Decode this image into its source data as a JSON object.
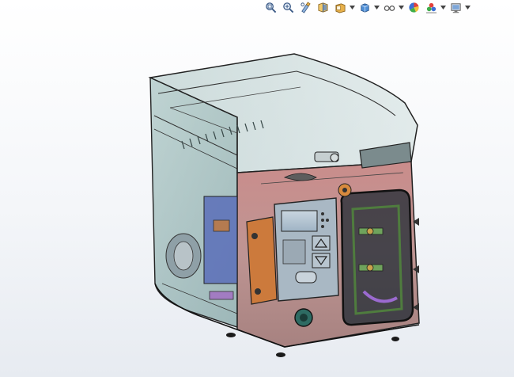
{
  "heads_up_toolbar": {
    "items": [
      {
        "name": "zoom-to-fit-icon",
        "has_dropdown": false
      },
      {
        "name": "zoom-to-area-icon",
        "has_dropdown": false
      },
      {
        "name": "previous-view-icon",
        "has_dropdown": false
      },
      {
        "name": "section-view-icon",
        "has_dropdown": false
      },
      {
        "name": "view-orientation-icon",
        "has_dropdown": true
      },
      {
        "name": "display-style-icon",
        "has_dropdown": true
      },
      {
        "name": "hide-show-items-icon",
        "has_dropdown": true
      },
      {
        "name": "edit-appearance-icon",
        "has_dropdown": false
      },
      {
        "name": "apply-scene-icon",
        "has_dropdown": true
      },
      {
        "name": "view-settings-icon",
        "has_dropdown": true
      }
    ]
  },
  "colors": {
    "viewport_top": "#ffffff",
    "viewport_bottom": "#e7ebf1",
    "housing_glass": "#7fa9a6",
    "front_panel": "#c47a74",
    "motor_blue": "#5a6fb8",
    "display_screen": "#b9cad6"
  }
}
